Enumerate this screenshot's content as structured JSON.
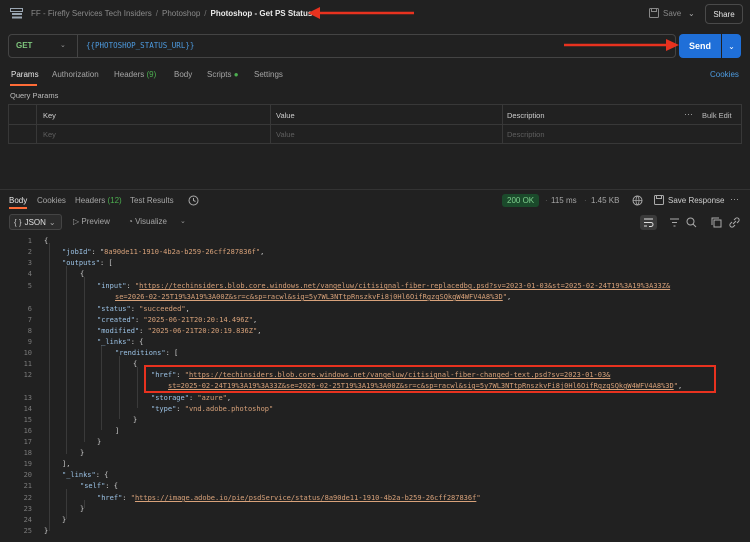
{
  "breadcrumb": {
    "workspace": "FF - Firefly Services Tech Insiders",
    "collection": "Photoshop",
    "request": "Photoshop - Get PS Status"
  },
  "header": {
    "save_label": "Save",
    "share_label": "Share"
  },
  "request": {
    "method": "GET",
    "url": "{{PHOTOSHOP_STATUS_URL}}",
    "send_label": "Send"
  },
  "request_tabs": {
    "params": "Params",
    "authorization": "Authorization",
    "headers": "Headers",
    "headers_count": "(9)",
    "body": "Body",
    "scripts": "Scripts",
    "settings": "Settings",
    "cookies": "Cookies"
  },
  "query_params": {
    "title": "Query Params",
    "columns": [
      "Key",
      "Value",
      "Description"
    ],
    "placeholders": [
      "Key",
      "Value",
      "Description"
    ],
    "bulk_edit": "Bulk Edit"
  },
  "response_tabs": {
    "body": "Body",
    "cookies": "Cookies",
    "headers": "Headers",
    "headers_count": "(12)",
    "test_results": "Test Results"
  },
  "response_meta": {
    "status": "200 OK",
    "time": "115 ms",
    "size": "1.45 KB",
    "save_response": "Save Response"
  },
  "view_options": {
    "format": "JSON",
    "preview": "Preview",
    "visualize": "Visualize"
  },
  "code": {
    "job_id": "8a90de11-1910-4b2a-b259-26cff287836f",
    "input_href_1": "https://techinsiders.blob.core.windows.net/vangeluw/citisignal-fiber-replacedbg.psd?sv=2023-01-03&st=2025-02-24T19%3A19%3A33Z&",
    "input_href_2": "se=2026-02-25T19%3A19%3A00Z&sr=c&sp=racwl&sig=5y7WL3NTtpRnszkvFi8j0Hl6OifRgzqSQkgW4WFV4A8%3D",
    "status": "succeeded",
    "created": "2025-06-21T20:20:14.496Z",
    "modified": "2025-06-21T20:20:19.836Z",
    "rendition_href_1": "https://techinsiders.blob.core.windows.net/vangeluw/citisignal-fiber-changed-text.psd?sv=2023-01-03&",
    "rendition_href_2": "st=2025-02-24T19%3A19%3A33Z&se=2026-02-25T19%3A19%3A00Z&sr=c&sp=racwl&sig=5y7WL3NTtpRnszkvFi8j0Hl6OifRgzqSQkgW4WFV4A8%3D",
    "storage": "azure",
    "type": "vnd.adobe.photoshop",
    "self_href": "https://image.adobe.io/pie/psdService/status/8a90de11-1910-4b2a-b259-26cff287836f"
  },
  "colors": {
    "accent": "#ff6c37",
    "send": "#1f6fd8",
    "annotation": "#e8321f"
  }
}
